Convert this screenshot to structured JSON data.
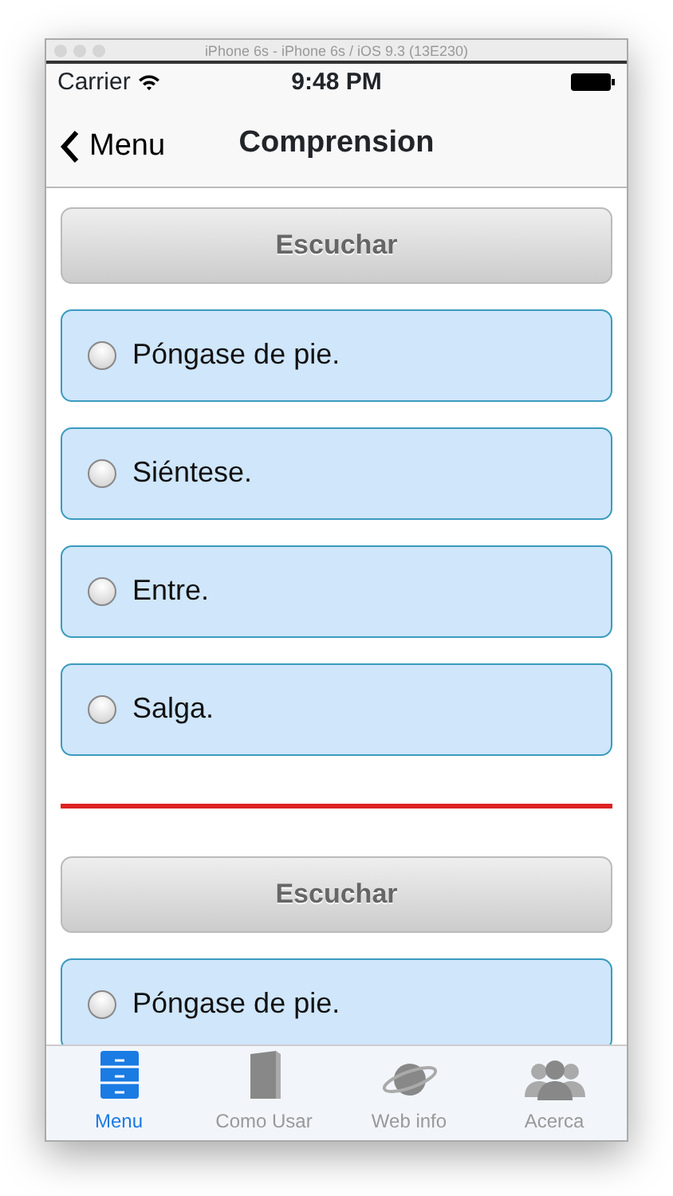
{
  "window": {
    "title": "iPhone 6s - iPhone 6s / iOS 9.3 (13E230)"
  },
  "status_bar": {
    "carrier": "Carrier",
    "time": "9:48 PM"
  },
  "nav_bar": {
    "back": "Menu",
    "title": "Comprension"
  },
  "questions": [
    {
      "listen_button": "Escuchar",
      "options": [
        {
          "label": "Póngase de pie.",
          "selected": false
        },
        {
          "label": "Siéntese.",
          "selected": false
        },
        {
          "label": "Entre.",
          "selected": false
        },
        {
          "label": "Salga.",
          "selected": false
        }
      ]
    },
    {
      "listen_button": "Escuchar",
      "options": [
        {
          "label": "Póngase de pie.",
          "selected": false
        }
      ]
    }
  ],
  "tab_bar": [
    {
      "label": "Menu",
      "kind": "cabinet",
      "selected": true
    },
    {
      "label": "Como Usar",
      "kind": "book",
      "selected": false
    },
    {
      "label": "Web info",
      "kind": "planet",
      "selected": false
    },
    {
      "label": "Acerca",
      "kind": "people",
      "selected": false
    }
  ]
}
